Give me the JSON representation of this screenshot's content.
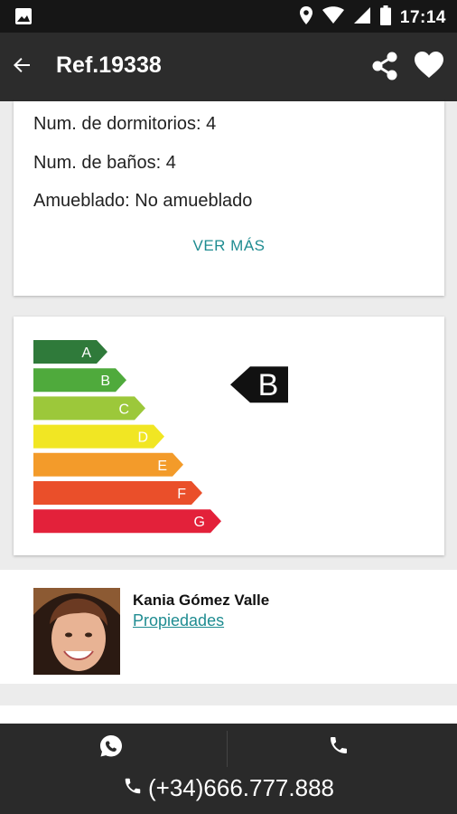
{
  "status_bar": {
    "time": "17:14",
    "icons": [
      "image-icon",
      "location-icon",
      "wifi-icon",
      "signal-icon",
      "battery-icon"
    ]
  },
  "app_bar": {
    "title": "Ref.19338",
    "icons": [
      "back-arrow-icon",
      "share-icon",
      "heart-icon"
    ]
  },
  "details": {
    "items": [
      "Num. de dormitorios: 4",
      "Num. de baños: 4",
      "Amueblado: No amueblado"
    ],
    "ver_mas": "VER MÁS"
  },
  "energy": {
    "grades": [
      {
        "label": "A",
        "color": "#2f7a3a"
      },
      {
        "label": "B",
        "color": "#4faa3c"
      },
      {
        "label": "C",
        "color": "#9cc83a"
      },
      {
        "label": "D",
        "color": "#f1e623"
      },
      {
        "label": "E",
        "color": "#f39b2a"
      },
      {
        "label": "F",
        "color": "#ea4f2a"
      },
      {
        "label": "G",
        "color": "#e3213a"
      }
    ],
    "rating": "B"
  },
  "agent": {
    "name": "Kania Gómez Valle",
    "link": "Propiedades"
  },
  "bottom_bar": {
    "phone": "(+34)666.777.888",
    "icons": [
      "whatsapp-icon",
      "call-icon"
    ]
  },
  "colors": {
    "accent": "#1f8c91",
    "appbar": "#2c2c2c",
    "statusbar": "#161616"
  }
}
